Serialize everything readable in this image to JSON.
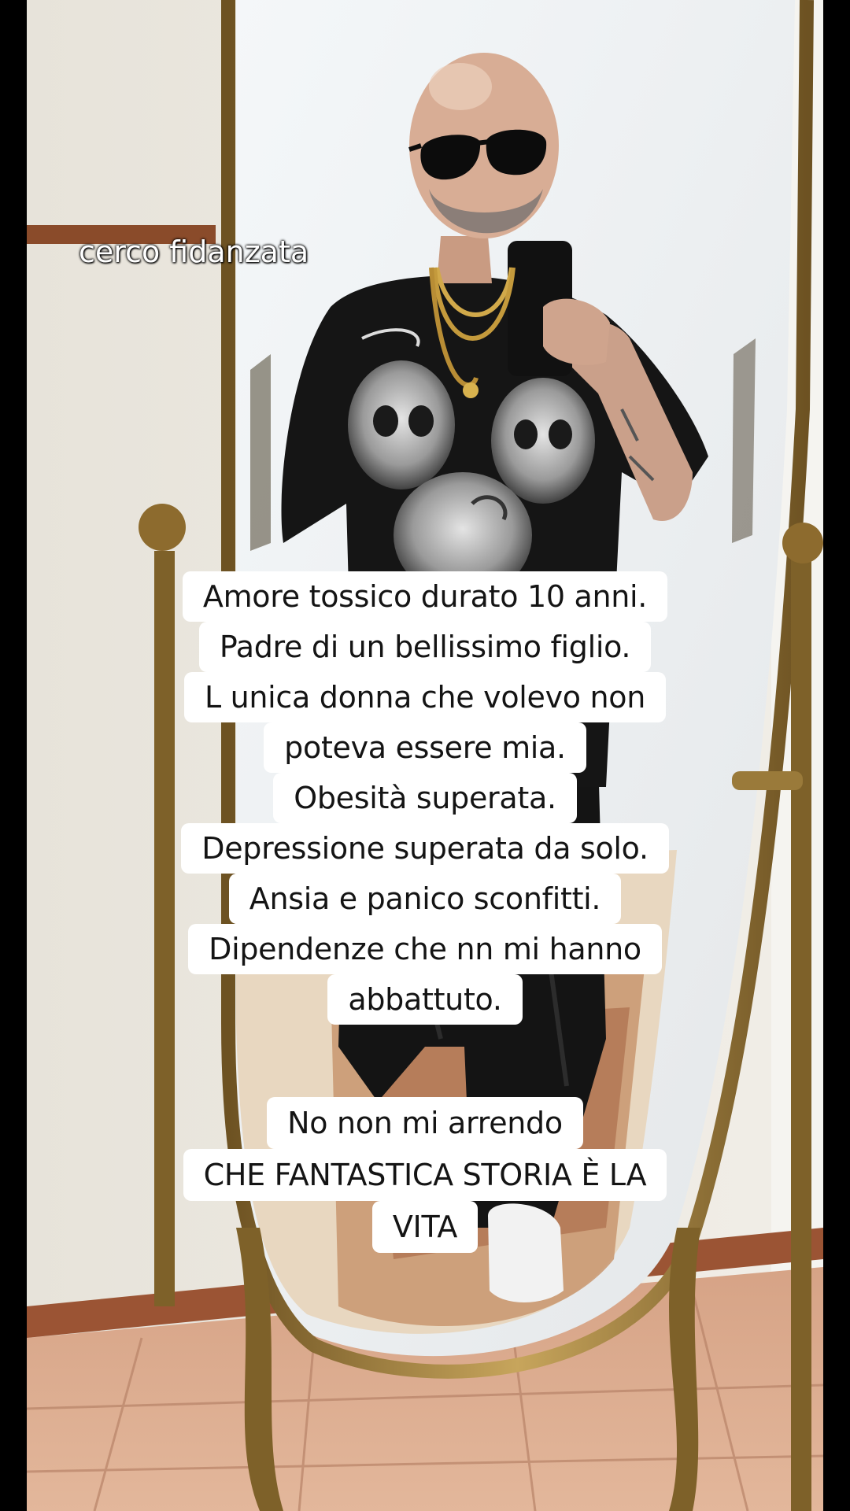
{
  "top_caption": "cerco fidanzata",
  "story_lines": [
    "Amore tossico durato 10 anni.",
    "Padre di un bellissimo figlio.",
    "L unica donna che volevo non",
    "poteva essere mia.",
    "Obesità superata.",
    "Depressione superata da solo.",
    "Ansia e panico sconfitti.",
    "Dipendenze che nn mi hanno",
    "abbattuto."
  ],
  "closing_lines": [
    "No non mi arrendo",
    "CHE FANTASTICA STORIA È  LA",
    "VITA"
  ],
  "colors": {
    "wall": "#ece8df",
    "mirror_frame": "#a98a45",
    "floor_tile": "#d9a98a",
    "shirt": "#151515",
    "caption_box": "#ffffff"
  }
}
